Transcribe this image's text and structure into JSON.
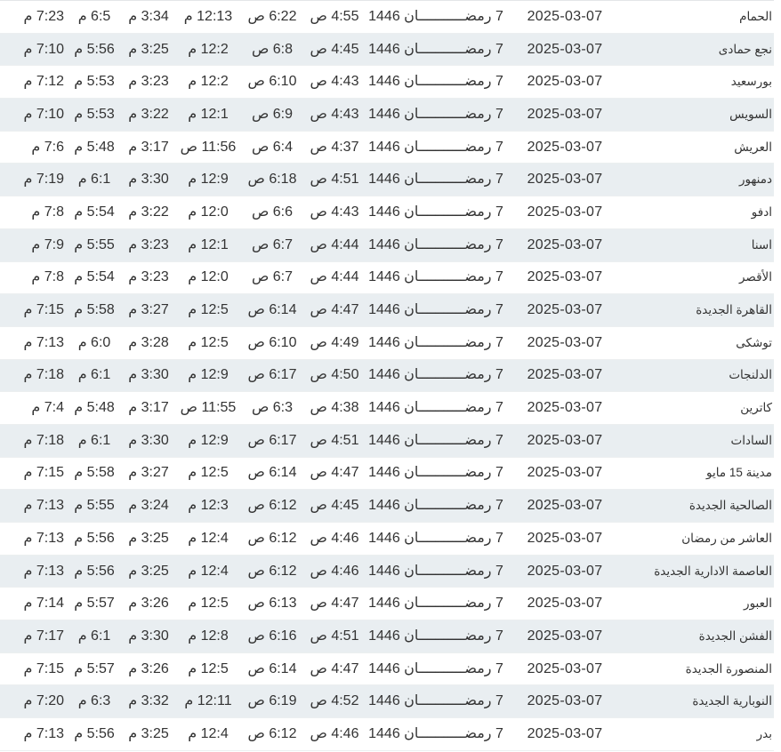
{
  "rows": [
    {
      "city": "الحمام",
      "gregorian": "2025-03-07",
      "hijri": "7 رمضـــــــــــان 1446",
      "fajr": "4:55 ص",
      "sunrise": "6:22 ص",
      "dhuhr": "12:13 م",
      "asr": "3:34 م",
      "maghrib": "6:5 م",
      "isha": "7:23 م"
    },
    {
      "city": "نجع حمادى",
      "gregorian": "2025-03-07",
      "hijri": "7 رمضـــــــــــان 1446",
      "fajr": "4:45 ص",
      "sunrise": "6:8 ص",
      "dhuhr": "12:2 م",
      "asr": "3:25 م",
      "maghrib": "5:56 م",
      "isha": "7:10 م"
    },
    {
      "city": "بورسعيد",
      "gregorian": "2025-03-07",
      "hijri": "7 رمضـــــــــــان 1446",
      "fajr": "4:43 ص",
      "sunrise": "6:10 ص",
      "dhuhr": "12:2 م",
      "asr": "3:23 م",
      "maghrib": "5:53 م",
      "isha": "7:12 م"
    },
    {
      "city": "السويس",
      "gregorian": "2025-03-07",
      "hijri": "7 رمضـــــــــــان 1446",
      "fajr": "4:43 ص",
      "sunrise": "6:9 ص",
      "dhuhr": "12:1 م",
      "asr": "3:22 م",
      "maghrib": "5:53 م",
      "isha": "7:10 م"
    },
    {
      "city": "العريش",
      "gregorian": "2025-03-07",
      "hijri": "7 رمضـــــــــــان 1446",
      "fajr": "4:37 ص",
      "sunrise": "6:4 ص",
      "dhuhr": "11:56 ص",
      "asr": "3:17 م",
      "maghrib": "5:48 م",
      "isha": "7:6 م"
    },
    {
      "city": "دمنهور",
      "gregorian": "2025-03-07",
      "hijri": "7 رمضـــــــــــان 1446",
      "fajr": "4:51 ص",
      "sunrise": "6:18 ص",
      "dhuhr": "12:9 م",
      "asr": "3:30 م",
      "maghrib": "6:1 م",
      "isha": "7:19 م"
    },
    {
      "city": "ادفو",
      "gregorian": "2025-03-07",
      "hijri": "7 رمضـــــــــــان 1446",
      "fajr": "4:43 ص",
      "sunrise": "6:6 ص",
      "dhuhr": "12:0 م",
      "asr": "3:22 م",
      "maghrib": "5:54 م",
      "isha": "7:8 م"
    },
    {
      "city": "اسنا",
      "gregorian": "2025-03-07",
      "hijri": "7 رمضـــــــــــان 1446",
      "fajr": "4:44 ص",
      "sunrise": "6:7 ص",
      "dhuhr": "12:1 م",
      "asr": "3:23 م",
      "maghrib": "5:55 م",
      "isha": "7:9 م"
    },
    {
      "city": "الأقصر",
      "gregorian": "2025-03-07",
      "hijri": "7 رمضـــــــــــان 1446",
      "fajr": "4:44 ص",
      "sunrise": "6:7 ص",
      "dhuhr": "12:0 م",
      "asr": "3:23 م",
      "maghrib": "5:54 م",
      "isha": "7:8 م"
    },
    {
      "city": "القاهرة الجديدة",
      "gregorian": "2025-03-07",
      "hijri": "7 رمضـــــــــــان 1446",
      "fajr": "4:47 ص",
      "sunrise": "6:14 ص",
      "dhuhr": "12:5 م",
      "asr": "3:27 م",
      "maghrib": "5:58 م",
      "isha": "7:15 م"
    },
    {
      "city": "توشكى",
      "gregorian": "2025-03-07",
      "hijri": "7 رمضـــــــــــان 1446",
      "fajr": "4:49 ص",
      "sunrise": "6:10 ص",
      "dhuhr": "12:5 م",
      "asr": "3:28 م",
      "maghrib": "6:0 م",
      "isha": "7:13 م"
    },
    {
      "city": "الدلنجات",
      "gregorian": "2025-03-07",
      "hijri": "7 رمضـــــــــــان 1446",
      "fajr": "4:50 ص",
      "sunrise": "6:17 ص",
      "dhuhr": "12:9 م",
      "asr": "3:30 م",
      "maghrib": "6:1 م",
      "isha": "7:18 م"
    },
    {
      "city": "كاترين",
      "gregorian": "2025-03-07",
      "hijri": "7 رمضـــــــــــان 1446",
      "fajr": "4:38 ص",
      "sunrise": "6:3 ص",
      "dhuhr": "11:55 ص",
      "asr": "3:17 م",
      "maghrib": "5:48 م",
      "isha": "7:4 م"
    },
    {
      "city": "السادات",
      "gregorian": "2025-03-07",
      "hijri": "7 رمضـــــــــــان 1446",
      "fajr": "4:51 ص",
      "sunrise": "6:17 ص",
      "dhuhr": "12:9 م",
      "asr": "3:30 م",
      "maghrib": "6:1 م",
      "isha": "7:18 م"
    },
    {
      "city": "مدينة 15 مايو",
      "gregorian": "2025-03-07",
      "hijri": "7 رمضـــــــــــان 1446",
      "fajr": "4:47 ص",
      "sunrise": "6:14 ص",
      "dhuhr": "12:5 م",
      "asr": "3:27 م",
      "maghrib": "5:58 م",
      "isha": "7:15 م"
    },
    {
      "city": "الصالحية الجديدة",
      "gregorian": "2025-03-07",
      "hijri": "7 رمضـــــــــــان 1446",
      "fajr": "4:45 ص",
      "sunrise": "6:12 ص",
      "dhuhr": "12:3 م",
      "asr": "3:24 م",
      "maghrib": "5:55 م",
      "isha": "7:13 م"
    },
    {
      "city": "العاشر من رمضان",
      "gregorian": "2025-03-07",
      "hijri": "7 رمضـــــــــــان 1446",
      "fajr": "4:46 ص",
      "sunrise": "6:12 ص",
      "dhuhr": "12:4 م",
      "asr": "3:25 م",
      "maghrib": "5:56 م",
      "isha": "7:13 م"
    },
    {
      "city": "العاصمة الادارية الجديدة",
      "gregorian": "2025-03-07",
      "hijri": "7 رمضـــــــــــان 1446",
      "fajr": "4:46 ص",
      "sunrise": "6:12 ص",
      "dhuhr": "12:4 م",
      "asr": "3:25 م",
      "maghrib": "5:56 م",
      "isha": "7:13 م"
    },
    {
      "city": "العبور",
      "gregorian": "2025-03-07",
      "hijri": "7 رمضـــــــــــان 1446",
      "fajr": "4:47 ص",
      "sunrise": "6:13 ص",
      "dhuhr": "12:5 م",
      "asr": "3:26 م",
      "maghrib": "5:57 م",
      "isha": "7:14 م"
    },
    {
      "city": "الفشن الجديدة",
      "gregorian": "2025-03-07",
      "hijri": "7 رمضـــــــــــان 1446",
      "fajr": "4:51 ص",
      "sunrise": "6:16 ص",
      "dhuhr": "12:8 م",
      "asr": "3:30 م",
      "maghrib": "6:1 م",
      "isha": "7:17 م"
    },
    {
      "city": "المنصورة الجديدة",
      "gregorian": "2025-03-07",
      "hijri": "7 رمضـــــــــــان 1446",
      "fajr": "4:47 ص",
      "sunrise": "6:14 ص",
      "dhuhr": "12:5 م",
      "asr": "3:26 م",
      "maghrib": "5:57 م",
      "isha": "7:15 م"
    },
    {
      "city": "النوبارية الجديدة",
      "gregorian": "2025-03-07",
      "hijri": "7 رمضـــــــــــان 1446",
      "fajr": "4:52 ص",
      "sunrise": "6:19 ص",
      "dhuhr": "12:11 م",
      "asr": "3:32 م",
      "maghrib": "6:3 م",
      "isha": "7:20 م"
    },
    {
      "city": "بدر",
      "gregorian": "2025-03-07",
      "hijri": "7 رمضـــــــــــان 1446",
      "fajr": "4:46 ص",
      "sunrise": "6:12 ص",
      "dhuhr": "12:4 م",
      "asr": "3:25 م",
      "maghrib": "5:56 م",
      "isha": "7:13 م"
    }
  ]
}
